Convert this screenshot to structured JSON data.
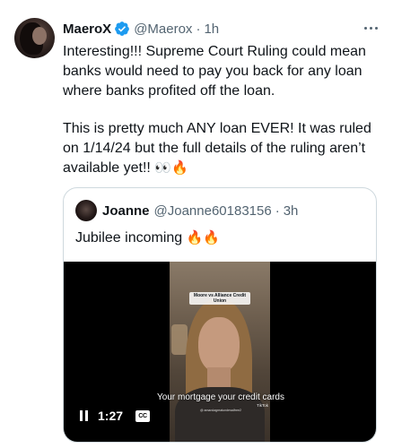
{
  "tweet": {
    "author": {
      "name": "MaeroX",
      "handle": "@Maerox",
      "time": "1h",
      "verified_color": "#1d9bf0"
    },
    "text_p1": "Interesting!!! Supreme Court Ruling could mean banks would need to pay you back for any loan where banks profited off the loan.",
    "text_p2": "This is pretty much ANY loan EVER! It was ruled on 1/14/24 but the full details of the ruling aren’t available yet!!",
    "text_p2_emojis": [
      "eyes-emoji",
      "fire-emoji"
    ],
    "more_icon": "more-dots-icon"
  },
  "quote": {
    "author": {
      "name": "Joanne",
      "handle": "@Joanne60183156",
      "time": "3h"
    },
    "text": "Jubilee incoming",
    "text_emojis": [
      "fire-emoji",
      "fire-emoji"
    ],
    "video": {
      "overlay_top": "Moore vs Alliance Credit Union",
      "subtitle": "Your mortgage your credit cards",
      "watermark": "TikTok",
      "watermark_user": "@ amandagreatunderadfree2",
      "duration": "1:27",
      "cc_label": "CC"
    }
  },
  "colors": {
    "text": "#0f1419",
    "secondary": "#536471",
    "border": "#cfd9de",
    "blue": "#1d9bf0"
  }
}
